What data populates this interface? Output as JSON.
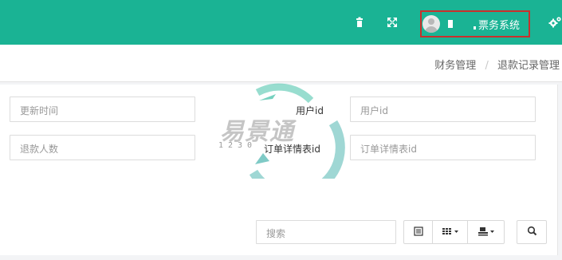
{
  "header": {
    "user_name": "票务系统",
    "icons": [
      "trash-icon",
      "expand-icon",
      "user-avatar",
      "cogs-icon"
    ]
  },
  "breadcrumb": {
    "items": [
      "财务管理",
      "退款记录管理"
    ],
    "separator": "/"
  },
  "filters": {
    "update_time_placeholder": "更新时间",
    "refund_count_placeholder": "退款人数",
    "user_id_label": "用户id",
    "user_id_placeholder": "用户id",
    "order_detail_label": "订单详情表id",
    "order_detail_placeholder": "订单详情表id"
  },
  "toolbar": {
    "search_placeholder": "搜索",
    "icons": [
      "list-icon",
      "grid-icon",
      "export-icon",
      "search-icon"
    ]
  },
  "watermark": {
    "text": "易景通",
    "digits": "1230"
  },
  "colors": {
    "topbar": "#1ab394",
    "highlight_border": "#c9302c",
    "watermark_teal": "#2aa7a0"
  }
}
